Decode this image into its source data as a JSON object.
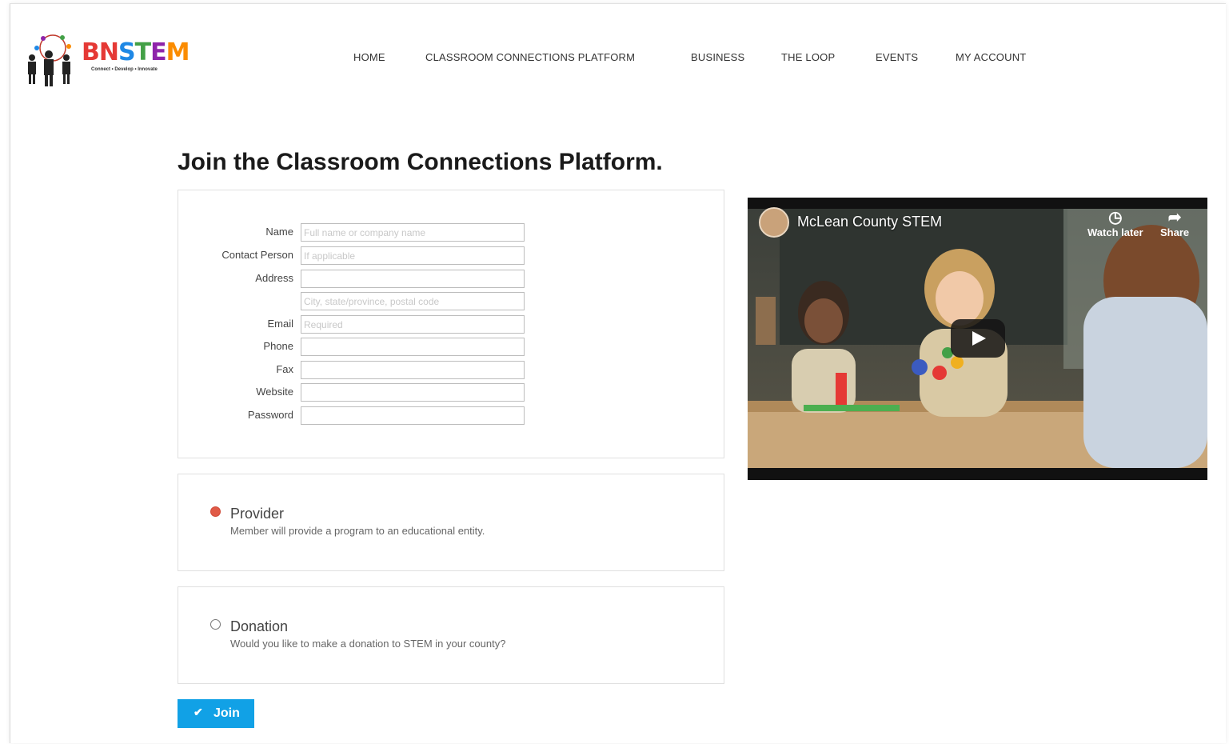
{
  "brand": {
    "logo_text_parts": [
      "B",
      "N",
      "S",
      "T",
      "E",
      "M"
    ],
    "tagline": "Connect • Develop • Innovate"
  },
  "nav": {
    "items": [
      {
        "label": "HOME"
      },
      {
        "label": "CLASSROOM CONNECTIONS PLATFORM"
      },
      {
        "label": "BUSINESS"
      },
      {
        "label": "THE LOOP"
      },
      {
        "label": "EVENTS"
      },
      {
        "label": "MY ACCOUNT"
      }
    ]
  },
  "page": {
    "title": "Join the Classroom Connections Platform."
  },
  "form": {
    "fields": [
      {
        "label": "Name",
        "placeholder": "Full name or company name",
        "value": ""
      },
      {
        "label": "Contact Person",
        "placeholder": "If applicable",
        "value": ""
      },
      {
        "label": "Address",
        "placeholder": "",
        "value": ""
      },
      {
        "label": "",
        "placeholder": "City, state/province, postal code",
        "value": ""
      },
      {
        "label": "Email",
        "placeholder": "Required",
        "value": ""
      },
      {
        "label": "Phone",
        "placeholder": "",
        "value": ""
      },
      {
        "label": "Fax",
        "placeholder": "",
        "value": ""
      },
      {
        "label": "Website",
        "placeholder": "",
        "value": ""
      },
      {
        "label": "Password",
        "placeholder": "",
        "value": ""
      }
    ]
  },
  "options": [
    {
      "title": "Provider",
      "description": "Member will provide a program to an educational entity.",
      "selected": true
    },
    {
      "title": "Donation",
      "description": "Would you like to make a donation to STEM in your county?",
      "selected": false
    }
  ],
  "join_button": {
    "label": "Join",
    "icon": "check-icon"
  },
  "video": {
    "title": "McLean County STEM",
    "watch_later_label": "Watch later",
    "share_label": "Share",
    "icons": [
      "clock-icon",
      "share-icon",
      "play-icon"
    ]
  },
  "colors": {
    "accent_blue": "#11a1e6",
    "radio_selected": "#e05a47",
    "title_text": "#1a1a1a"
  }
}
